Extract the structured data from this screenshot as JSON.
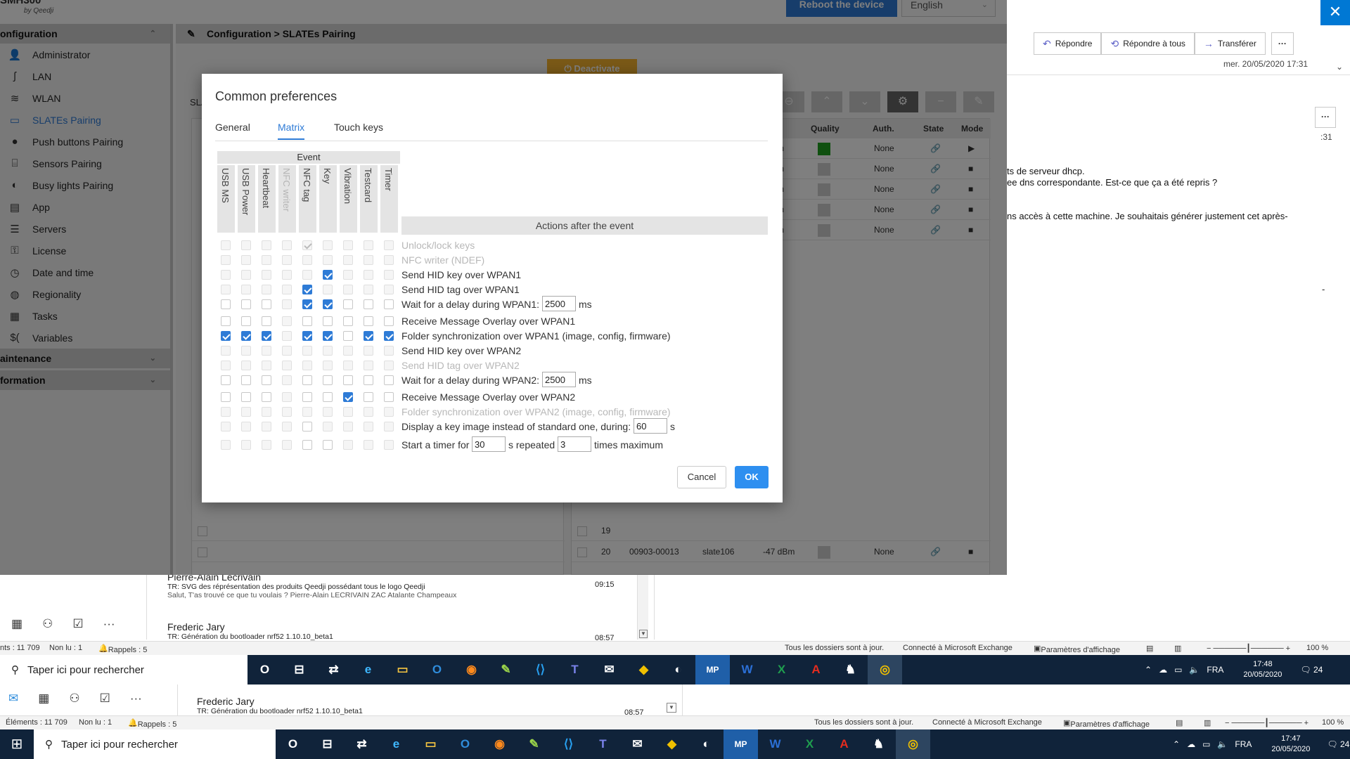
{
  "app": {
    "logo": "SMH300",
    "logo_sub": "by Qeedji",
    "reboot_label": "Reboot the device",
    "language": "English",
    "breadcrumb": "Configuration > SLATEs Pairing",
    "deactivate_label": "Deactivate",
    "slates_label": "SLA",
    "sidebar": {
      "section_configuration": "onfiguration",
      "section_maintenance": "aintenance",
      "section_information": "formation",
      "items": [
        {
          "label": "Administrator",
          "icon": "user-icon"
        },
        {
          "label": "LAN",
          "icon": "lan-icon"
        },
        {
          "label": "WLAN",
          "icon": "wifi-icon"
        },
        {
          "label": "SLATEs Pairing",
          "icon": "slate-icon",
          "active": true
        },
        {
          "label": "Push buttons Pairing",
          "icon": "push-button-icon"
        },
        {
          "label": "Sensors Pairing",
          "icon": "sensor-icon"
        },
        {
          "label": "Busy lights Pairing",
          "icon": "busy-light-icon"
        },
        {
          "label": "App",
          "icon": "app-icon"
        },
        {
          "label": "Servers",
          "icon": "servers-icon"
        },
        {
          "label": "License",
          "icon": "key-icon"
        },
        {
          "label": "Date and time",
          "icon": "clock-icon"
        },
        {
          "label": "Regionality",
          "icon": "globe-icon"
        },
        {
          "label": "Tasks",
          "icon": "tasks-icon"
        },
        {
          "label": "Variables",
          "icon": "variables-icon"
        }
      ]
    },
    "grid": {
      "headers": {
        "quality": "Quality",
        "auth": "Auth.",
        "state": "State",
        "mode": "Mode"
      },
      "rows": [
        {
          "num": "",
          "mac": "",
          "name": "",
          "rssi": "m",
          "quality": "green",
          "auth": "None"
        },
        {
          "num": "",
          "mac": "",
          "name": "",
          "rssi": "m",
          "quality": "grey",
          "auth": "None"
        },
        {
          "num": "",
          "mac": "",
          "name": "",
          "rssi": "m",
          "quality": "grey",
          "auth": "None"
        },
        {
          "num": "",
          "mac": "",
          "name": "",
          "rssi": "m",
          "quality": "grey",
          "auth": "None"
        },
        {
          "num": "",
          "mac": "",
          "name": "",
          "rssi": "m",
          "quality": "grey",
          "auth": "None"
        }
      ],
      "row19": {
        "num": "19"
      },
      "row20": {
        "num": "20",
        "mac": "00903-00013",
        "name": "slate106",
        "rssi": "-47 dBm",
        "auth": "None"
      }
    }
  },
  "dialog": {
    "title": "Common preferences",
    "tabs": [
      {
        "label": "General",
        "active": false
      },
      {
        "label": "Matrix",
        "active": true
      },
      {
        "label": "Touch keys",
        "active": false
      }
    ],
    "event_header": "Event",
    "actions_header": "Actions after the event",
    "event_columns": [
      {
        "label": "USB MS",
        "dim": false
      },
      {
        "label": "USB Power",
        "dim": false
      },
      {
        "label": "Heartbeat",
        "dim": false
      },
      {
        "label": "NFC writer",
        "dim": true
      },
      {
        "label": "NFC tag",
        "dim": false
      },
      {
        "label": "Key",
        "dim": false
      },
      {
        "label": "Vibration",
        "dim": false
      },
      {
        "label": "Testcard",
        "dim": false
      },
      {
        "label": "Timer",
        "dim": false
      }
    ],
    "rows": [
      {
        "action": "Unlock/lock keys",
        "disabled": true,
        "checks": [
          "d",
          "d",
          "d",
          "d",
          "cd",
          "d",
          "d",
          "d",
          "d"
        ]
      },
      {
        "action": "NFC writer (NDEF)",
        "disabled": true,
        "checks": [
          "d",
          "d",
          "d",
          "d",
          "d",
          "d",
          "d",
          "d",
          "d"
        ]
      },
      {
        "action": "Send HID key over WPAN1",
        "disabled": false,
        "checks": [
          "d",
          "d",
          "d",
          "d",
          "d",
          "c",
          "d",
          "d",
          "d"
        ]
      },
      {
        "action": "Send HID tag over WPAN1",
        "disabled": false,
        "checks": [
          "d",
          "d",
          "d",
          "d",
          "c",
          "d",
          "d",
          "d",
          "d"
        ]
      },
      {
        "action": "Wait for a delay during WPAN1:",
        "disabled": false,
        "input1": "2500",
        "unit1": "ms",
        "checks": [
          "u",
          "u",
          "u",
          "d",
          "c",
          "c",
          "u",
          "u",
          "u"
        ]
      },
      {
        "action": "Receive Message Overlay over WPAN1",
        "disabled": false,
        "checks": [
          "u",
          "u",
          "u",
          "d",
          "u",
          "u",
          "u",
          "u",
          "u"
        ]
      },
      {
        "action": "Folder synchronization over WPAN1 (image, config, firmware)",
        "disabled": false,
        "checks": [
          "c",
          "c",
          "c",
          "d",
          "c",
          "c",
          "u",
          "c",
          "c"
        ]
      },
      {
        "action": "Send HID key over WPAN2",
        "disabled": false,
        "checks": [
          "d",
          "d",
          "d",
          "d",
          "d",
          "d",
          "d",
          "d",
          "d"
        ]
      },
      {
        "action": "Send HID tag over WPAN2",
        "disabled": true,
        "checks": [
          "d",
          "d",
          "d",
          "d",
          "d",
          "d",
          "d",
          "d",
          "d"
        ]
      },
      {
        "action": "Wait for a delay during WPAN2:",
        "disabled": false,
        "input1": "2500",
        "unit1": "ms",
        "checks": [
          "u",
          "u",
          "u",
          "d",
          "u",
          "u",
          "u",
          "u",
          "u"
        ]
      },
      {
        "action": "Receive Message Overlay over WPAN2",
        "disabled": false,
        "checks": [
          "u",
          "u",
          "u",
          "d",
          "u",
          "u",
          "c",
          "u",
          "u"
        ]
      },
      {
        "action": "Folder synchronization over WPAN2 (image, config, firmware)",
        "disabled": true,
        "checks": [
          "d",
          "d",
          "d",
          "d",
          "d",
          "d",
          "d",
          "d",
          "d"
        ]
      },
      {
        "action": "Display a key image instead of standard one, during:",
        "disabled": false,
        "input1": "60",
        "unit1": "s",
        "checks": [
          "d",
          "d",
          "d",
          "d",
          "u",
          "d",
          "d",
          "d",
          "d"
        ]
      },
      {
        "action": "Start a timer for",
        "disabled": false,
        "input1": "30",
        "unit1": "s repeated",
        "input2": "3",
        "unit2": "times maximum",
        "checks": [
          "d",
          "d",
          "d",
          "d",
          "u",
          "u",
          "d",
          "d",
          "d"
        ]
      }
    ],
    "cancel_label": "Cancel",
    "ok_label": "OK"
  },
  "outlook": {
    "reply": "Répondre",
    "reply_all": "Répondre à tous",
    "forward": "Transférer",
    "more": "···",
    "date": "mer. 20/05/2020 17:31",
    "small_time": ":31",
    "small_box": "···",
    "body_lines": [
      "ts de serveur dhcp.",
      "ee dns correspondante. Est-ce que ça a été repris ?",
      "ns accès à cette machine. Je souhaitais générer justement cet après-"
    ],
    "dash": "-",
    "messages": [
      {
        "from": "Pierre-Alain Lécrivain",
        "subject": "TR: SVG des réprésentation des produits Qeedji possédant tous le logo Qeedji",
        "preview": "Salut,  T'as trouvé ce que tu voulais ?  Pierre-Alain LECRIVAIN  ZAC Atalante Champeaux",
        "time": "09:15"
      },
      {
        "from": "Frederic Jary",
        "subject": "TR: Génération du bootloader nrf52 1.10.10_beta1",
        "time": "08:57"
      }
    ],
    "bottom_message": {
      "from": "Frederic Jary",
      "subject": "TR: Génération du bootloader nrf52 1.10.10_beta1",
      "time": "08:57"
    },
    "status1": {
      "elements": "nts : 11 709",
      "unread": "Non lu : 1",
      "reminders": "Rappels : 5",
      "sync": "Tous les dossiers sont à jour.",
      "exchange": "Connecté à Microsoft Exchange",
      "display": "Paramètres d'affichage",
      "zoom": "100 %"
    },
    "status2": {
      "elements": "Éléments : 11 709",
      "unread": "Non lu : 1",
      "reminders": "Rappels : 5",
      "sync": "Tous les dossiers sont à jour.",
      "exchange": "Connecté à Microsoft Exchange",
      "display": "Paramètres d'affichage",
      "zoom": "100 %"
    }
  },
  "taskbar": {
    "search_placeholder": "Taper ici pour rechercher",
    "lang": "FRA",
    "time": "17:48",
    "date": "20/05/2020",
    "notif": "24",
    "time2": "17:47",
    "date2": "20/05/2020",
    "apps": [
      "O",
      "⊟",
      "⇄",
      "e",
      "▭",
      "O",
      "◉",
      "✎",
      "⟨⟩",
      "T",
      "✉",
      "◆",
      "◐",
      "MP",
      "W",
      "X",
      "A",
      "♞",
      "◎"
    ]
  }
}
